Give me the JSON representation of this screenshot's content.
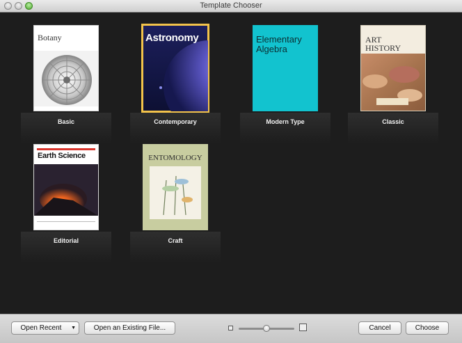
{
  "window": {
    "title": "Template Chooser"
  },
  "templates": [
    {
      "label": "Basic",
      "cover_title": "Botany"
    },
    {
      "label": "Contemporary",
      "cover_title": "Astronomy",
      "selected": true
    },
    {
      "label": "Modern Type",
      "cover_title": "Elementary Algebra"
    },
    {
      "label": "Classic",
      "cover_title": "ART HISTORY"
    },
    {
      "label": "Editorial",
      "cover_title": "Earth Science"
    },
    {
      "label": "Craft",
      "cover_title": "ENTOMOLOGY"
    }
  ],
  "footer": {
    "open_recent": "Open Recent",
    "open_existing": "Open an Existing File...",
    "cancel": "Cancel",
    "choose": "Choose"
  },
  "colors": {
    "selection": "#f3c34a",
    "background": "#1d1d1d"
  }
}
